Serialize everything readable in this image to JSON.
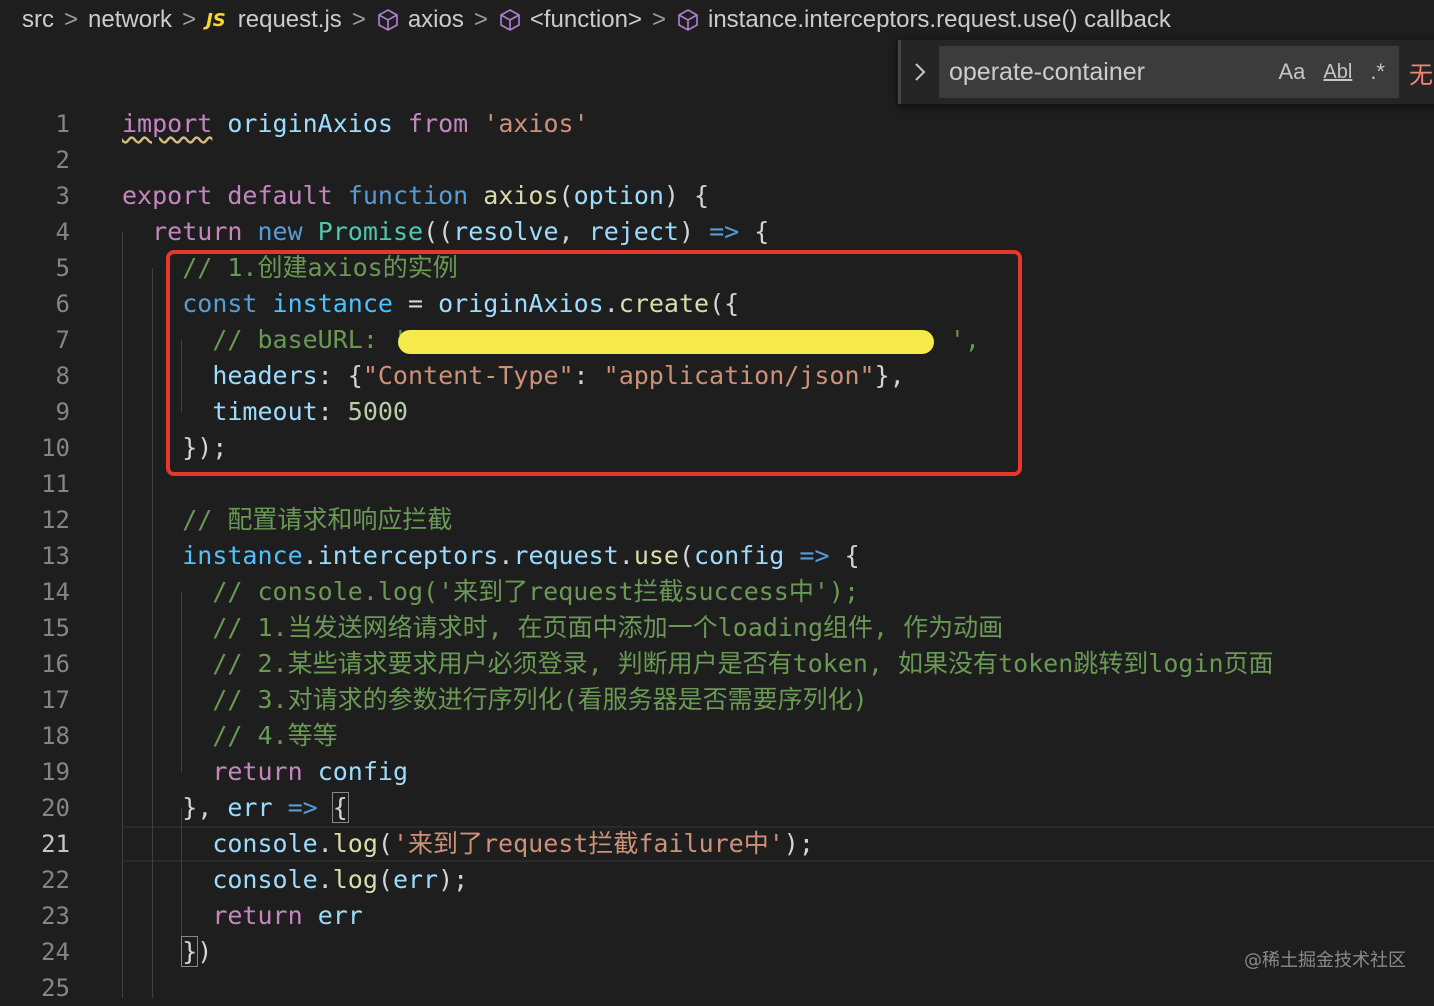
{
  "breadcrumb": {
    "items": [
      "src",
      "network",
      "request.js",
      "axios",
      "<function>",
      "instance.interceptors.request.use() callback"
    ],
    "js_badge": "JS"
  },
  "find": {
    "value": "operate-container",
    "opt_case": "Aa",
    "opt_word": "Abl",
    "opt_regex": ".*",
    "no_results": "无"
  },
  "lines": [
    {
      "n": "1",
      "tokens": [
        [
          "kw squiggle",
          "import"
        ],
        [
          "punc",
          " "
        ],
        [
          "var",
          "originAxios"
        ],
        [
          "punc",
          " "
        ],
        [
          "kw",
          "from"
        ],
        [
          "punc",
          " "
        ],
        [
          "str",
          "'axios'"
        ]
      ]
    },
    {
      "n": "2",
      "tokens": []
    },
    {
      "n": "3",
      "tokens": [
        [
          "kw",
          "export"
        ],
        [
          "punc",
          " "
        ],
        [
          "kw",
          "default"
        ],
        [
          "punc",
          " "
        ],
        [
          "fnkw",
          "function"
        ],
        [
          "punc",
          " "
        ],
        [
          "fn",
          "axios"
        ],
        [
          "punc",
          "("
        ],
        [
          "var",
          "option"
        ],
        [
          "punc",
          ") {"
        ]
      ]
    },
    {
      "n": "4",
      "tokens": [
        [
          "punc",
          "  "
        ],
        [
          "kw",
          "return"
        ],
        [
          "punc",
          " "
        ],
        [
          "fnkw",
          "new"
        ],
        [
          "punc",
          " "
        ],
        [
          "cls",
          "Promise"
        ],
        [
          "punc",
          "(("
        ],
        [
          "var",
          "resolve"
        ],
        [
          "punc",
          ", "
        ],
        [
          "var",
          "reject"
        ],
        [
          "punc",
          ") "
        ],
        [
          "fnkw",
          "=>"
        ],
        [
          "punc",
          " {"
        ]
      ]
    },
    {
      "n": "5",
      "tokens": [
        [
          "punc",
          "    "
        ],
        [
          "cmt",
          "// 1.创建axios的实例"
        ]
      ]
    },
    {
      "n": "6",
      "tokens": [
        [
          "punc",
          "    "
        ],
        [
          "fnkw",
          "const"
        ],
        [
          "punc",
          " "
        ],
        [
          "const",
          "instance"
        ],
        [
          "punc",
          " = "
        ],
        [
          "var",
          "originAxios"
        ],
        [
          "punc",
          "."
        ],
        [
          "fn",
          "create"
        ],
        [
          "punc",
          "({"
        ]
      ]
    },
    {
      "n": "7",
      "tokens": [
        [
          "punc",
          "      "
        ],
        [
          "cmt",
          "// baseURL: '"
        ],
        [
          "cmt",
          "                                    "
        ],
        [
          "cmt",
          "',"
        ]
      ]
    },
    {
      "n": "8",
      "tokens": [
        [
          "punc",
          "      "
        ],
        [
          "var",
          "headers"
        ],
        [
          "punc",
          ": {"
        ],
        [
          "str",
          "\"Content-Type\""
        ],
        [
          "punc",
          ": "
        ],
        [
          "str",
          "\"application/json\""
        ],
        [
          "punc",
          "},"
        ]
      ]
    },
    {
      "n": "9",
      "tokens": [
        [
          "punc",
          "      "
        ],
        [
          "var",
          "timeout"
        ],
        [
          "punc",
          ": "
        ],
        [
          "num",
          "5000"
        ]
      ]
    },
    {
      "n": "10",
      "tokens": [
        [
          "punc",
          "    });"
        ]
      ]
    },
    {
      "n": "11",
      "tokens": []
    },
    {
      "n": "12",
      "tokens": [
        [
          "punc",
          "    "
        ],
        [
          "cmt",
          "// 配置请求和响应拦截"
        ]
      ]
    },
    {
      "n": "13",
      "tokens": [
        [
          "punc",
          "    "
        ],
        [
          "const",
          "instance"
        ],
        [
          "punc",
          "."
        ],
        [
          "var",
          "interceptors"
        ],
        [
          "punc",
          "."
        ],
        [
          "var",
          "request"
        ],
        [
          "punc",
          "."
        ],
        [
          "fn",
          "use"
        ],
        [
          "punc",
          "("
        ],
        [
          "var",
          "config"
        ],
        [
          "punc",
          " "
        ],
        [
          "fnkw",
          "=>"
        ],
        [
          "punc",
          " {"
        ]
      ]
    },
    {
      "n": "14",
      "tokens": [
        [
          "punc",
          "      "
        ],
        [
          "cmt",
          "// console.log('来到了request拦截success中');"
        ]
      ]
    },
    {
      "n": "15",
      "tokens": [
        [
          "punc",
          "      "
        ],
        [
          "cmt",
          "// 1.当发送网络请求时, 在页面中添加一个loading组件, 作为动画"
        ]
      ]
    },
    {
      "n": "16",
      "tokens": [
        [
          "punc",
          "      "
        ],
        [
          "cmt",
          "// 2.某些请求要求用户必须登录, 判断用户是否有token, 如果没有token跳转到login页面"
        ]
      ]
    },
    {
      "n": "17",
      "tokens": [
        [
          "punc",
          "      "
        ],
        [
          "cmt",
          "// 3.对请求的参数进行序列化(看服务器是否需要序列化)"
        ]
      ]
    },
    {
      "n": "18",
      "tokens": [
        [
          "punc",
          "      "
        ],
        [
          "cmt",
          "// 4.等等"
        ]
      ]
    },
    {
      "n": "19",
      "tokens": [
        [
          "punc",
          "      "
        ],
        [
          "kw",
          "return"
        ],
        [
          "punc",
          " "
        ],
        [
          "var",
          "config"
        ]
      ]
    },
    {
      "n": "20",
      "tokens": [
        [
          "punc",
          "    }, "
        ],
        [
          "var",
          "err"
        ],
        [
          "punc",
          " "
        ],
        [
          "fnkw",
          "=>"
        ],
        [
          "punc",
          " "
        ],
        [
          "punc bracket-match",
          "{"
        ]
      ]
    },
    {
      "n": "21",
      "tokens": [
        [
          "punc",
          "      "
        ],
        [
          "var",
          "console"
        ],
        [
          "punc",
          "."
        ],
        [
          "fn",
          "log"
        ],
        [
          "punc",
          "("
        ],
        [
          "str",
          "'来到了request拦截failure中'"
        ],
        [
          "punc",
          ");"
        ]
      ],
      "active": true
    },
    {
      "n": "22",
      "tokens": [
        [
          "punc",
          "      "
        ],
        [
          "var",
          "console"
        ],
        [
          "punc",
          "."
        ],
        [
          "fn",
          "log"
        ],
        [
          "punc",
          "("
        ],
        [
          "var",
          "err"
        ],
        [
          "punc",
          ");"
        ]
      ]
    },
    {
      "n": "23",
      "tokens": [
        [
          "punc",
          "      "
        ],
        [
          "kw",
          "return"
        ],
        [
          "punc",
          " "
        ],
        [
          "var",
          "err"
        ]
      ]
    },
    {
      "n": "24",
      "tokens": [
        [
          "punc",
          "    "
        ],
        [
          "punc bracket-match",
          "}"
        ],
        [
          "punc",
          ")"
        ]
      ]
    },
    {
      "n": "25",
      "tokens": []
    }
  ],
  "watermark": "@稀土掘金技术社区",
  "colors": {
    "background": "#1e1e1e",
    "highlight_border": "#e8372a",
    "redaction": "#f5e94b"
  }
}
